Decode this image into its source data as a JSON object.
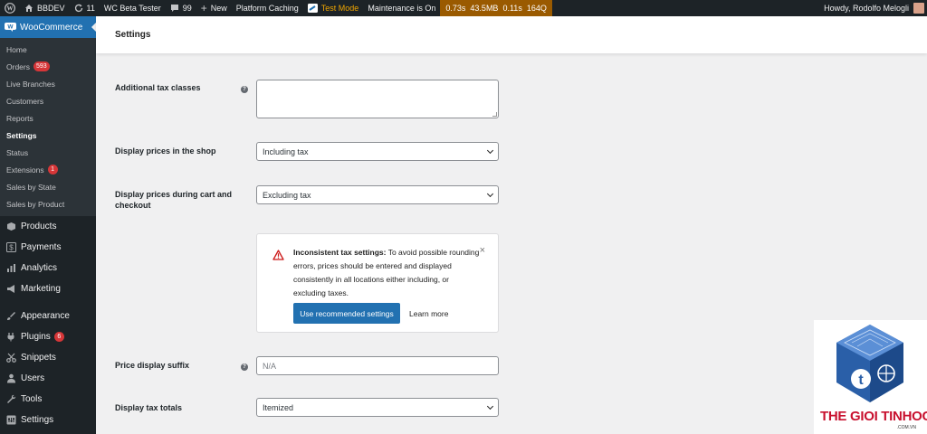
{
  "adminbar": {
    "site_name": "BBDEV",
    "updates_count": "11",
    "beta_tester": "WC Beta Tester",
    "comments_count": "99",
    "new_label": "New",
    "platform_caching": "Platform Caching",
    "test_mode": "Test Mode",
    "maintenance": "Maintenance is On",
    "perf_time": "0.73s",
    "perf_memory": "43.5MB",
    "perf_query_time": "0.11s",
    "perf_queries": "164Q",
    "howdy": "Howdy, Rodolfo Melogli"
  },
  "sidebar": {
    "woo_label": "WooCommerce",
    "submenu": [
      {
        "label": "Home"
      },
      {
        "label": "Orders",
        "badge": "593"
      },
      {
        "label": "Live Branches"
      },
      {
        "label": "Customers"
      },
      {
        "label": "Reports"
      },
      {
        "label": "Settings"
      },
      {
        "label": "Status"
      },
      {
        "label": "Extensions",
        "badge": "1"
      },
      {
        "label": "Sales by State"
      },
      {
        "label": "Sales by Product"
      }
    ],
    "menu": [
      {
        "label": "Products",
        "icon": "products-icon"
      },
      {
        "label": "Payments",
        "icon": "payments-icon"
      },
      {
        "label": "Analytics",
        "icon": "analytics-icon"
      },
      {
        "label": "Marketing",
        "icon": "marketing-icon"
      },
      {
        "label": "Appearance",
        "icon": "appearance-icon"
      },
      {
        "label": "Plugins",
        "icon": "plugins-icon",
        "badge": "6"
      },
      {
        "label": "Snippets",
        "icon": "snippets-icon"
      },
      {
        "label": "Users",
        "icon": "users-icon"
      },
      {
        "label": "Tools",
        "icon": "tools-icon"
      },
      {
        "label": "Settings",
        "icon": "settings-icon"
      }
    ]
  },
  "page": {
    "title": "Settings"
  },
  "form": {
    "additional_tax_classes": {
      "label": "Additional tax classes",
      "value": ""
    },
    "display_prices_shop": {
      "label": "Display prices in the shop",
      "value": "Including tax"
    },
    "display_prices_cart": {
      "label": "Display prices during cart and checkout",
      "value": "Excluding tax"
    },
    "price_display_suffix": {
      "label": "Price display suffix",
      "placeholder": "N/A"
    },
    "display_tax_totals": {
      "label": "Display tax totals",
      "value": "Itemized"
    }
  },
  "notice": {
    "title": "Inconsistent tax settings:",
    "body": "To avoid possible rounding errors, prices should be entered and displayed consistently in all locations either including, or excluding taxes.",
    "primary_button": "Use recommended settings",
    "secondary_button": "Learn more",
    "close_glyph": "×"
  },
  "watermark": {
    "text": "THE GIOI TINHOC",
    "sub": ".COM.VN"
  },
  "colors": {
    "admin_bar": "#1d2327",
    "accent": "#2271b1",
    "badge": "#d63638",
    "perf_bg": "#9a5a00",
    "test_mode": "#f0a500"
  }
}
